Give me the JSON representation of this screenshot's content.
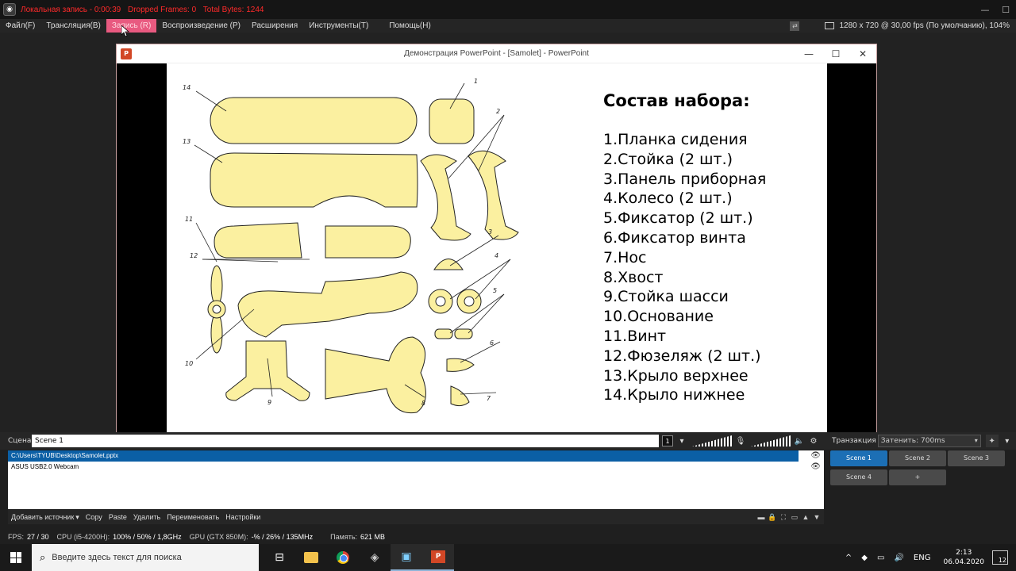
{
  "titlebar": {
    "rec_label": "Локальная запись - 0:00:39",
    "dropped": "Dropped Frames: 0",
    "bytes": "Total Bytes: 1244"
  },
  "menu": {
    "items": [
      "Файл(F)",
      "Трансляция(B)",
      "Запись (R)",
      "Воспроизведение (P)",
      "Расширения",
      "Инструменты(T)",
      "Помощь(H)"
    ],
    "resolution": "1280 x 720 @ 30,00 fps (По умолчанию), 104%"
  },
  "powerpoint": {
    "title": "Демонстрация PowerPoint - [Samolet] - PowerPoint",
    "logo": "P",
    "slide": {
      "heading": "Состав набора:",
      "parts": [
        "1.Планка сидения",
        "2.Стойка (2 шт.)",
        "3.Панель приборная",
        "4.Колесо (2 шт.)",
        "5.Фиксатор (2 шт.)",
        "6.Фиксатор винта",
        "7.Нос",
        "8.Хвост",
        "9.Стойка шасси",
        "10.Основание",
        "11.Винт",
        "12.Фюзеляж (2 шт.)",
        "13.Крыло верхнее",
        "14.Крыло нижнее"
      ],
      "diagram_numbers": [
        "14",
        "13",
        "12",
        "11",
        "10",
        "9",
        "8",
        "7",
        "6",
        "5",
        "4",
        "3",
        "2",
        "1"
      ]
    }
  },
  "scene_bar": {
    "label": "Сцена",
    "value": "Scene 1",
    "transition_label": "Транзакция",
    "transition_value": "Затенить: 700ms"
  },
  "sources": [
    {
      "name": "C:\\Users\\TYUB\\Desktop\\Samolet.pptx",
      "selected": true
    },
    {
      "name": "ASUS USB2.0 Webcam",
      "selected": false
    }
  ],
  "source_toolbar": [
    "Добавить источник",
    "Copy",
    "Paste",
    "Удалить",
    "Переименовать",
    "Настройки"
  ],
  "scenes": [
    "Scene 1",
    "Scene 2",
    "Scene 3",
    "Scene 4",
    "+"
  ],
  "status": {
    "fps_label": "FPS:",
    "fps": "27 / 30",
    "cpu_label": "CPU (i5-4200H):",
    "cpu": "100% / 50% / 1,8GHz",
    "gpu_label": "GPU (GTX 850M):",
    "gpu": "-% / 26% / 135MHz",
    "mem_label": "Память:",
    "mem": "621 MB"
  },
  "taskbar": {
    "search_placeholder": "Введите здесь текст для поиска",
    "lang": "ENG",
    "time": "2:13",
    "date": "06.04.2020",
    "notifications": "12"
  }
}
